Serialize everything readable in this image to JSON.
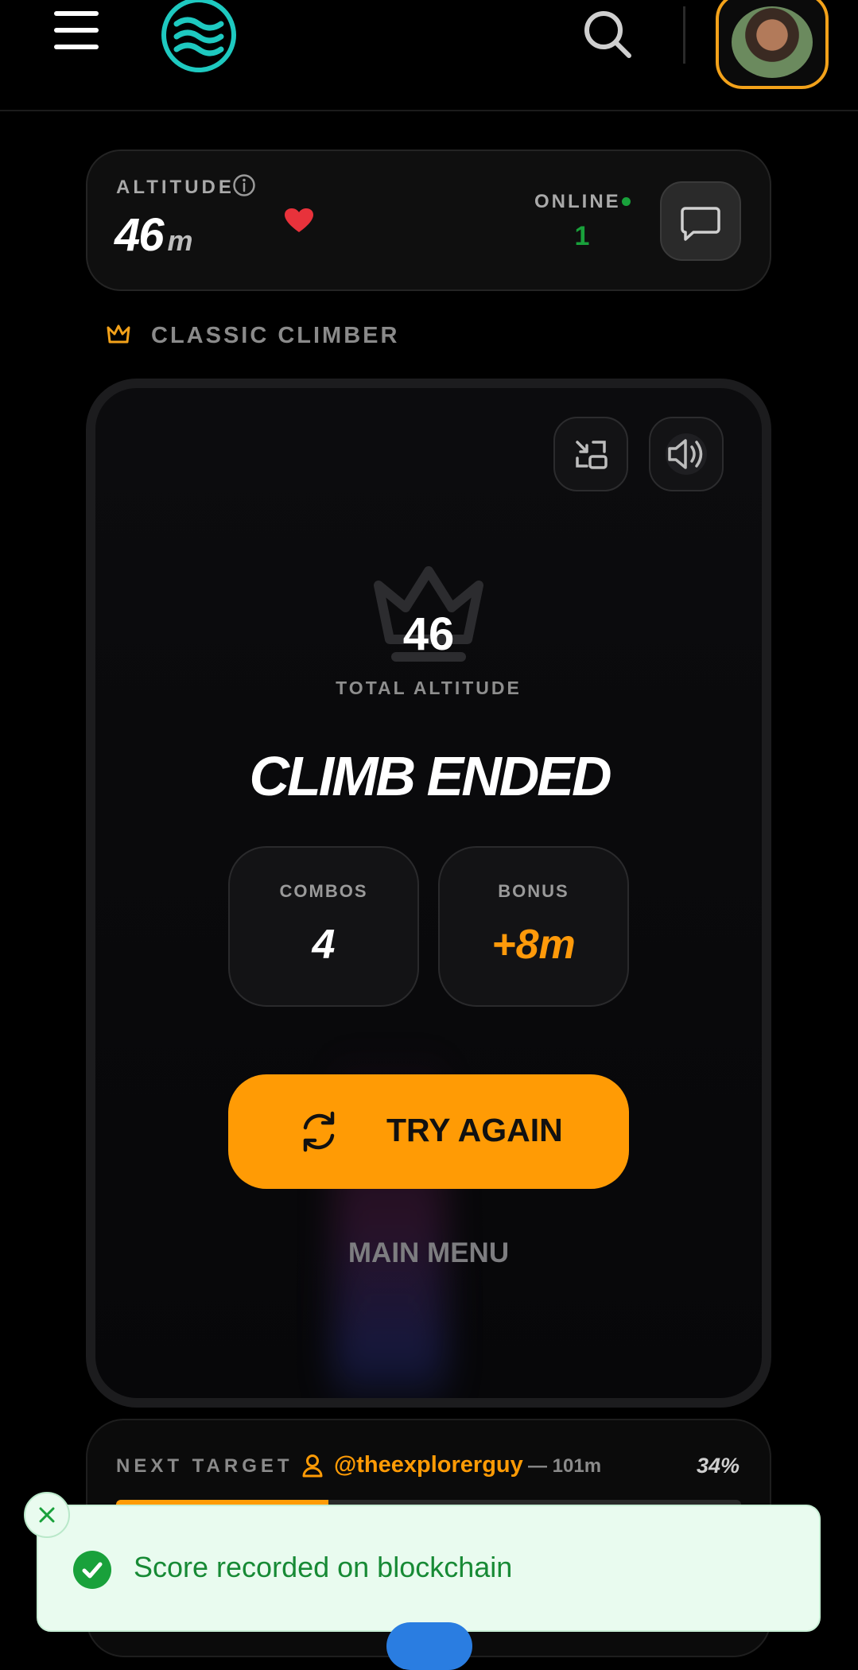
{
  "header": {
    "menu_icon": "hamburger-icon",
    "logo_icon": "waves-logo-icon",
    "search_icon": "search-icon",
    "avatar_icon": "user-avatar"
  },
  "altitude_card": {
    "label": "ALTITUDE",
    "value": "46",
    "unit": "m",
    "online_label": "ONLINE",
    "online_count": "1"
  },
  "mode": {
    "label": "CLASSIC CLIMBER"
  },
  "game": {
    "score": "46",
    "score_label": "TOTAL ALTITUDE",
    "title": "CLIMB ENDED",
    "stats": {
      "combos_label": "COMBOS",
      "combos_value": "4",
      "bonus_label": "BONUS",
      "bonus_value": "+8m"
    },
    "try_again_label": "TRY AGAIN",
    "main_menu_label": "MAIN MENU"
  },
  "next_target": {
    "label": "NEXT TARGET",
    "user": "@theexplorerguy",
    "distance": "— 101m",
    "percent": "34%",
    "progress": 0.34
  },
  "toast": {
    "message": "Score recorded on blockchain"
  },
  "colors": {
    "accent": "#ff9b05",
    "success": "#19a13b",
    "logo": "#1ec9c0",
    "heart": "#e8323b"
  }
}
